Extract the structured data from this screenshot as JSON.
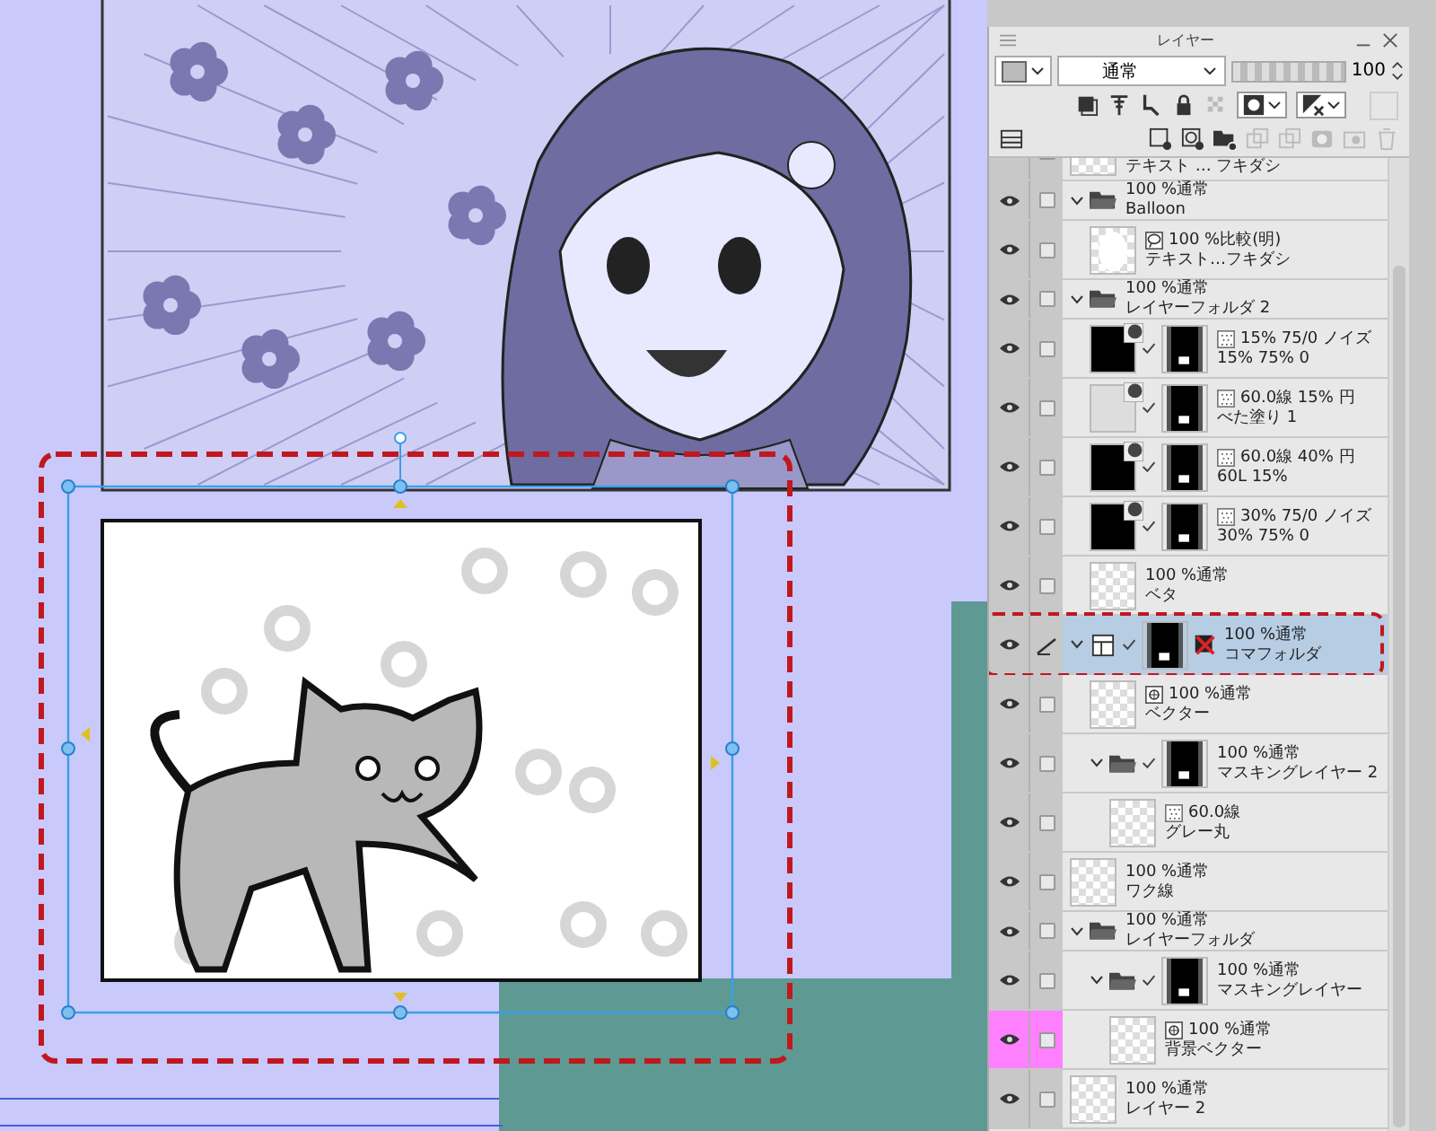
{
  "layer_panel": {
    "title": "レイヤー",
    "blend_mode": "通常",
    "opacity": {
      "level": 1.0,
      "value": "100"
    },
    "layers": [
      {
        "kind": "layer",
        "name": "テキスト … フキダシ",
        "thumbnail": {
          "kind": "checker"
        },
        "selected": false
      },
      {
        "kind": "folder",
        "mode": "100 %通常",
        "name": "Balloon",
        "expanded": true,
        "selected": false,
        "children": [
          {
            "kind": "layer",
            "badge": {
              "kind": "balloon"
            },
            "mode": "100 %比較(明)",
            "name": "テキスト…フキダシ",
            "thumbnail": {
              "kind": "white"
            },
            "selected": false
          }
        ]
      },
      {
        "kind": "folder",
        "mode": "100 %通常",
        "name": "レイヤーフォルダ 2",
        "expanded": true,
        "selected": false,
        "children": [
          {
            "kind": "fill",
            "badge": {
              "kind": "tone"
            },
            "mode": "15% 75/0 ノイズ",
            "name": "15% 75% 0",
            "thumbnail": {
              "kind": "dark"
            },
            "mask": true,
            "selected": false
          },
          {
            "kind": "fill",
            "badge": {
              "kind": "tone"
            },
            "mode": "60.0線 15% 円",
            "name": "べた塗り 1",
            "thumbnail": {
              "kind": "light"
            },
            "mask": true,
            "selected": false
          },
          {
            "kind": "fill",
            "badge": {
              "kind": "tone"
            },
            "mode": "60.0線 40% 円",
            "name": "60L 15%",
            "thumbnail": {
              "kind": "dark"
            },
            "mask": true,
            "selected": false
          },
          {
            "kind": "fill",
            "badge": {
              "kind": "tone"
            },
            "mode": "30% 75/0 ノイズ",
            "name": "30% 75% 0",
            "thumbnail": {
              "kind": "dark"
            },
            "mask": true,
            "selected": false
          },
          {
            "kind": "layer",
            "mode": "100 %通常",
            "name": "ベタ",
            "thumbnail": {
              "kind": "checker"
            },
            "selected": false
          }
        ]
      },
      {
        "kind": "folder",
        "frame": true,
        "mode": "100 %通常",
        "name": "コマフォルダ",
        "expanded": true,
        "mask": true,
        "mask_off": true,
        "selected": true,
        "children": [
          {
            "kind": "layer",
            "badge": {
              "kind": "vector"
            },
            "mode": "100 %通常",
            "name": "ベクター",
            "thumbnail": {
              "kind": "checker"
            },
            "selected": false
          },
          {
            "kind": "folder",
            "mode": "100 %通常",
            "name": "マスキングレイヤー 2",
            "expanded": true,
            "mask": true,
            "selected": false,
            "children": [
              {
                "kind": "layer",
                "badge": {
                  "kind": "tone"
                },
                "mode": "60.0線",
                "name": "グレー丸",
                "thumbnail": {
                  "kind": "checker"
                },
                "selected": false
              }
            ]
          }
        ]
      },
      {
        "kind": "layer",
        "mode": "100 %通常",
        "name": "ワク線",
        "thumbnail": {
          "kind": "checker"
        },
        "selected": false
      },
      {
        "kind": "folder",
        "mode": "100 %通常",
        "name": "レイヤーフォルダ",
        "expanded": true,
        "selected": false,
        "children": [
          {
            "kind": "folder",
            "mode": "100 %通常",
            "name": "マスキングレイヤー",
            "expanded": true,
            "mask": true,
            "selected": false,
            "children": [
              {
                "kind": "layer",
                "badge": {
                  "kind": "vector"
                },
                "mode": "100 %通常",
                "name": "背景ベクター",
                "thumbnail": {
                  "kind": "checker"
                },
                "color": "#ff80ff",
                "selected": false
              }
            ]
          }
        ]
      },
      {
        "kind": "layer",
        "mode": "100 %通常",
        "name": "レイヤー 2",
        "thumbnail": {
          "kind": "checker"
        },
        "selected": false
      }
    ]
  }
}
